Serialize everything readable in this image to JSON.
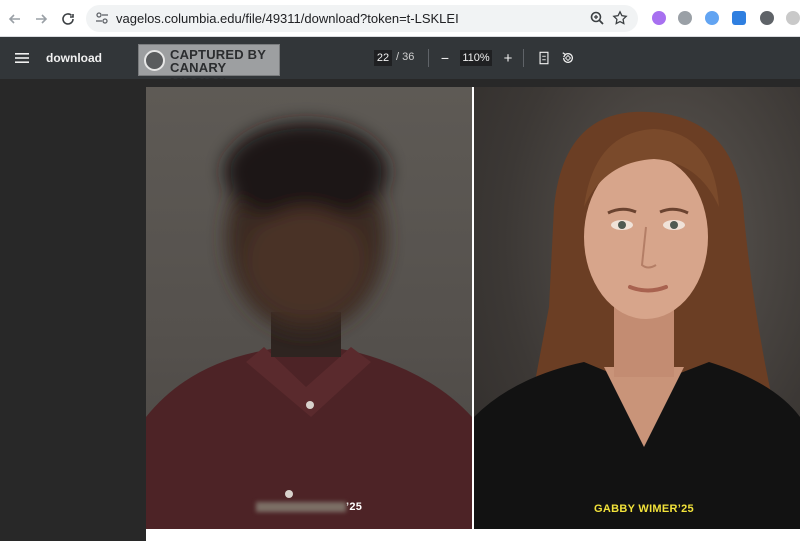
{
  "browser": {
    "url": "vagelos.columbia.edu/file/49311/download?token=t-LSKLEI",
    "icons": [
      "back-arrow-icon",
      "forward-arrow-icon",
      "reload-icon",
      "site-settings-icon",
      "zoom-icon",
      "star-icon"
    ]
  },
  "toolbar": {
    "title": "download",
    "watermark_line1": "CAPTURED BY",
    "watermark_line2": "CANARY MISSION",
    "current_page": "22",
    "total_pages": "/ 36",
    "zoom": "110%",
    "zoom_out_label": "−",
    "zoom_in_label": "+"
  },
  "document": {
    "left_caption_suffix": "’25",
    "right_caption": "GABBY WIMER’25",
    "right_caption_color": "#f2e23a"
  }
}
